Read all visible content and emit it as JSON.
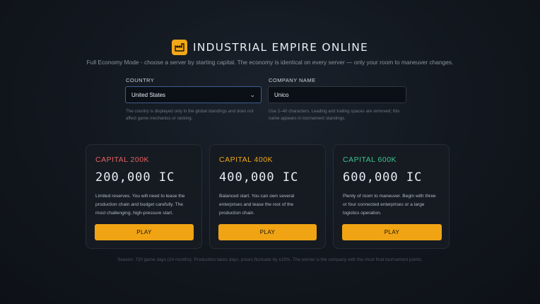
{
  "header": {
    "title": "INDUSTRIAL EMPIRE ONLINE",
    "subtitle": "Full Economy Mode - choose a server by starting capital. The economy is identical on every server — only your room to maneuver changes."
  },
  "form": {
    "country": {
      "label": "COUNTRY",
      "value": "United States",
      "hint_line1": "The country is displayed only in the global standings and does not",
      "hint_line2": "affect game mechanics or ranking."
    },
    "company": {
      "label": "COMPANY NAME",
      "value": "Unico",
      "hint_line1": "Use 2–40 characters. Leading and trailing spaces are removed; this",
      "hint_line2": "name appears in tournament standings."
    }
  },
  "servers": [
    {
      "name": "CAPITAL 200K",
      "amount": "200,000 IC",
      "accent": "#e86060",
      "desc_lines": [
        "Limited reserves. You will need to lease the",
        "production chain and budget carefully. The",
        "most challenging, high-pressure start."
      ],
      "button": "PLAY"
    },
    {
      "name": "CAPITAL 400K",
      "amount": "400,000 IC",
      "accent": "#f0a818",
      "desc_lines": [
        "Balanced start. You can own several",
        "enterprises and lease the rest of the",
        "production chain."
      ],
      "button": "PLAY"
    },
    {
      "name": "CAPITAL 600K",
      "amount": "600,000 IC",
      "accent": "#3cc48c",
      "desc_lines": [
        "Plenty of room to maneuver. Begin with three",
        "or four connected enterprises or a large",
        "logistics operation."
      ],
      "button": "PLAY"
    }
  ],
  "footer": "Season: 720 game days (24 months). Production takes days, prices fluctuate by ±15%. The winner is the company with the most final tournament points.",
  "colors": {
    "accent": "#f0a414",
    "background": "#12171e"
  }
}
